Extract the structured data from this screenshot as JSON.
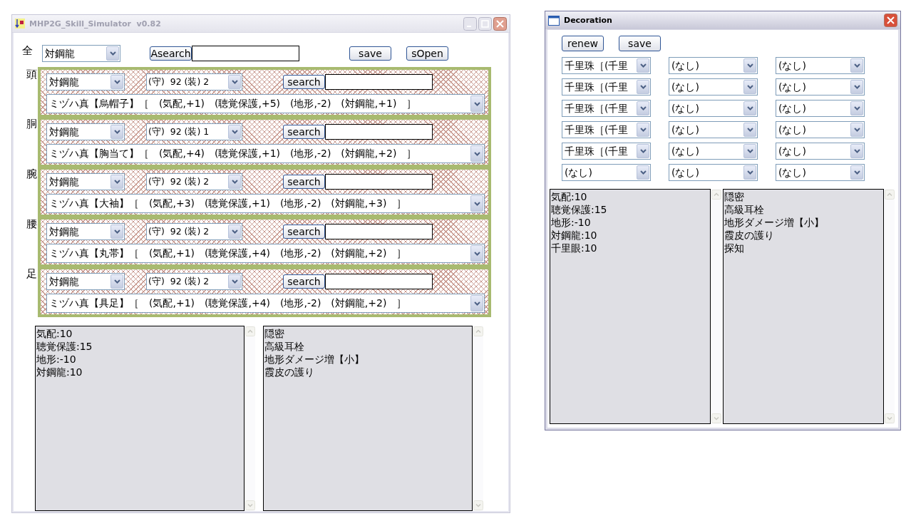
{
  "main_window": {
    "title": "MHP2G_Skill_Simulator  v0.82",
    "all_row": {
      "label": "全",
      "filter": "対鋼龍",
      "asearch_button": "Asearch",
      "save_button": "save",
      "sopen_button": "sOpen"
    },
    "parts": [
      {
        "label": "頭",
        "filter": "対鋼龍",
        "slots": "(守)  92 (装) 2",
        "search_button": "search",
        "armor": "ミヅハ真【烏帽子】［　(気配,+1)　(聴覚保護,+5)　(地形,-2)　(対鋼龍,+1)　］"
      },
      {
        "label": "胴",
        "filter": "対鋼龍",
        "slots": "(守)  92 (装) 1",
        "search_button": "search",
        "armor": "ミヅハ真【胸当て】［　(気配,+4)　(聴覚保護,+1)　(地形,-2)　(対鋼龍,+2)　］"
      },
      {
        "label": "腕",
        "filter": "対鋼龍",
        "slots": "(守)  92 (装) 2",
        "search_button": "search",
        "armor": "ミヅハ真【大袖】［　(気配,+3)　(聴覚保護,+1)　(地形,-2)　(対鋼龍,+3)　］"
      },
      {
        "label": "腰",
        "filter": "対鋼龍",
        "slots": "(守)  92 (装) 2",
        "search_button": "search",
        "armor": "ミヅハ真【丸帯】［　(気配,+1)　(聴覚保護,+4)　(地形,-2)　(対鋼龍,+2)　］"
      },
      {
        "label": "足",
        "filter": "対鋼龍",
        "slots": "(守)  92 (装) 2",
        "search_button": "search",
        "armor": "ミヅハ真【具足】［　(気配,+1)　(聴覚保護,+4)　(地形,-2)　(対鋼龍,+2)　］"
      }
    ],
    "skill_points": [
      "気配:10",
      "聴覚保護:15",
      "地形:-10",
      "対鋼龍:10"
    ],
    "skills": [
      "隠密",
      "高級耳栓",
      "地形ダメージ増【小】",
      "霞皮の護り"
    ]
  },
  "decoration_window": {
    "title": "Decoration",
    "buttons": [
      "renew",
      "save"
    ],
    "slots": [
      [
        "千里珠［(千里",
        "(なし)",
        "(なし)"
      ],
      [
        "千里珠［(千里",
        "(なし)",
        "(なし)"
      ],
      [
        "千里珠［(千里",
        "(なし)",
        "(なし)"
      ],
      [
        "千里珠［(千里",
        "(なし)",
        "(なし)"
      ],
      [
        "千里珠［(千里",
        "(なし)",
        "(なし)"
      ],
      [
        "(なし)",
        "(なし)",
        "(なし)"
      ]
    ],
    "skill_points": [
      "気配:10",
      "聴覚保護:15",
      "地形:-10",
      "対鋼龍:10",
      "千里眼:10"
    ],
    "skills": [
      "隠密",
      "高級耳栓",
      "地形ダメージ増【小】",
      "霞皮の護り",
      "探知"
    ]
  }
}
